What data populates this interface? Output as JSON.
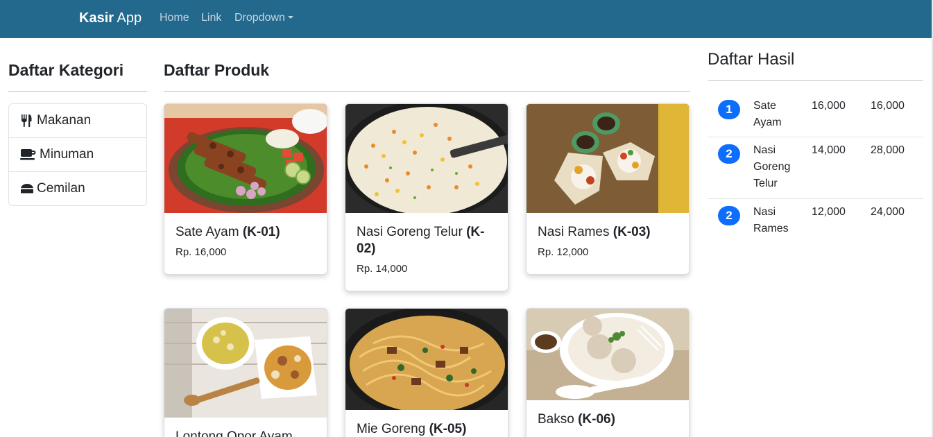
{
  "navbar": {
    "brand_bold": "Kasir",
    "brand_rest": "App",
    "links": [
      "Home",
      "Link",
      "Dropdown"
    ],
    "color": "#23688d"
  },
  "categories": {
    "title": "Daftar Kategori",
    "items": [
      {
        "label": "Makanan",
        "icon": "utensils-icon"
      },
      {
        "label": "Minuman",
        "icon": "coffee-icon"
      },
      {
        "label": "Cemilan",
        "icon": "cheese-icon"
      }
    ]
  },
  "products": {
    "title": "Daftar Produk",
    "items": [
      {
        "name": "Sate Ayam",
        "code": "(K-01)",
        "price": "Rp. 16,000"
      },
      {
        "name": "Nasi Goreng Telur",
        "code": "(K-02)",
        "price": "Rp. 14,000"
      },
      {
        "name": "Nasi Rames",
        "code": "(K-03)",
        "price": "Rp. 12,000"
      },
      {
        "name": "Lontong Opor Ayam",
        "code": "",
        "price": ""
      },
      {
        "name": "Mie Goreng",
        "code": "(K-05)",
        "price": ""
      },
      {
        "name": "Bakso",
        "code": "(K-06)",
        "price": ""
      }
    ]
  },
  "results": {
    "title": "Daftar Hasil",
    "accent": "#0d6efd",
    "rows": [
      {
        "qty": "1",
        "name": "Sate Ayam",
        "price": "16,000",
        "total": "16,000"
      },
      {
        "qty": "2",
        "name": "Nasi Goreng Telur",
        "price": "14,000",
        "total": "28,000"
      },
      {
        "qty": "2",
        "name": "Nasi Rames",
        "price": "12,000",
        "total": "24,000"
      }
    ]
  }
}
